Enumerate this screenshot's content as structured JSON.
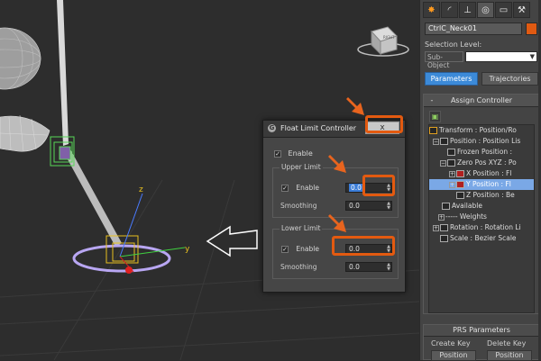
{
  "panel_tabs": [
    "create",
    "modify",
    "hierarchy",
    "motion",
    "display",
    "utilities"
  ],
  "object_name": "CtrlC_Neck01",
  "selection_level_label": "Selection Level:",
  "sub_object_label": "Sub-Object",
  "tab_parameters": "Parameters",
  "tab_trajectories": "Trajectories",
  "assign_controller_title": "Assign Controller",
  "rollout_minus": "-",
  "controller_tree": [
    "Transform : Position/Ro",
    "Position : Position Lis",
    "Frozen Position :",
    "Zero Pos XYZ : Po",
    "X Position : Fl",
    "Y Position : Fl",
    "Z Position : Be",
    "Available",
    "----- Weights",
    "Rotation : Rotation Li",
    "Scale : Bezier Scale"
  ],
  "prs_title": "PRS Parameters",
  "create_key_label": "Create Key",
  "delete_key_label": "Delete Key",
  "position_btn_1": "Position",
  "position_btn_2": "Position",
  "viewcube_label": "RIGHT",
  "dialog": {
    "title": "Float Limit Controller",
    "close_label": "x",
    "enable_label": "Enable",
    "upper_limit_label": "Upper Limit",
    "upper_enable_label": "Enable",
    "upper_value": "0.0",
    "upper_smoothing_label": "Smoothing",
    "upper_smoothing_value": "0.0",
    "lower_limit_label": "Lower Limit",
    "lower_enable_label": "Enable",
    "lower_value": "0.0",
    "lower_smoothing_label": "Smoothing",
    "lower_smoothing_value": "0.0",
    "checkmark": "✓"
  },
  "colors": {
    "highlight": "#e35a10",
    "accent_blue": "#3c8ad8",
    "selected_tree": "#7aa8e6"
  }
}
